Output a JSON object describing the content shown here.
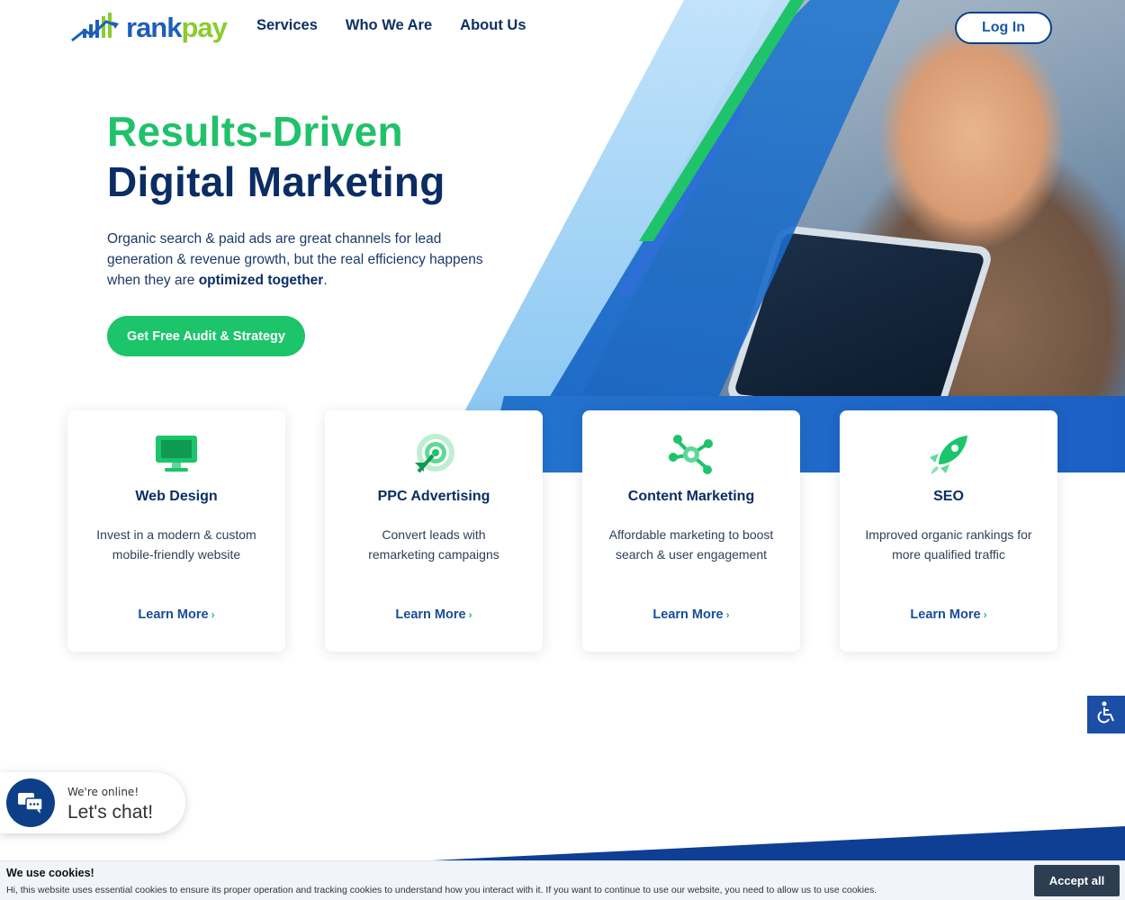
{
  "header": {
    "logo": "rankpay",
    "nav": [
      "Services",
      "Who We Are",
      "About Us"
    ],
    "login_label": "Log In"
  },
  "hero": {
    "title_line1": "Results-Driven",
    "title_line2": "Digital Marketing",
    "desc_part1": "Organic search & paid ads are great channels for lead generation & revenue growth, but the real efficiency happens when they are ",
    "desc_bold": "optimized together",
    "desc_end": ".",
    "cta_label": "Get Free Audit & Strategy"
  },
  "cards": [
    {
      "title": "Web Design",
      "desc": "Invest in a modern & custom mobile-friendly website",
      "link": "Learn More",
      "icon": "monitor-icon"
    },
    {
      "title": "PPC Advertising",
      "desc": "Convert leads with remarketing campaigns",
      "link": "Learn More",
      "icon": "target-icon"
    },
    {
      "title": "Content Marketing",
      "desc": "Affordable marketing to boost search & user engagement",
      "link": "Learn More",
      "icon": "network-icon"
    },
    {
      "title": "SEO",
      "desc": "Improved organic rankings for more qualified traffic",
      "link": "Learn More",
      "icon": "rocket-icon"
    }
  ],
  "chat": {
    "status": "We're online!",
    "prompt": "Let's chat!"
  },
  "cookie": {
    "title": "We use cookies!",
    "text": "Hi, this website uses essential cookies to ensure its proper operation and tracking cookies to understand how you interact with it. If you want to continue to use our website, you need to allow us to use cookies.",
    "accept_label": "Accept all"
  },
  "colors": {
    "green": "#1cc46a",
    "navy": "#0b2d63",
    "blue": "#1b5fc2"
  }
}
